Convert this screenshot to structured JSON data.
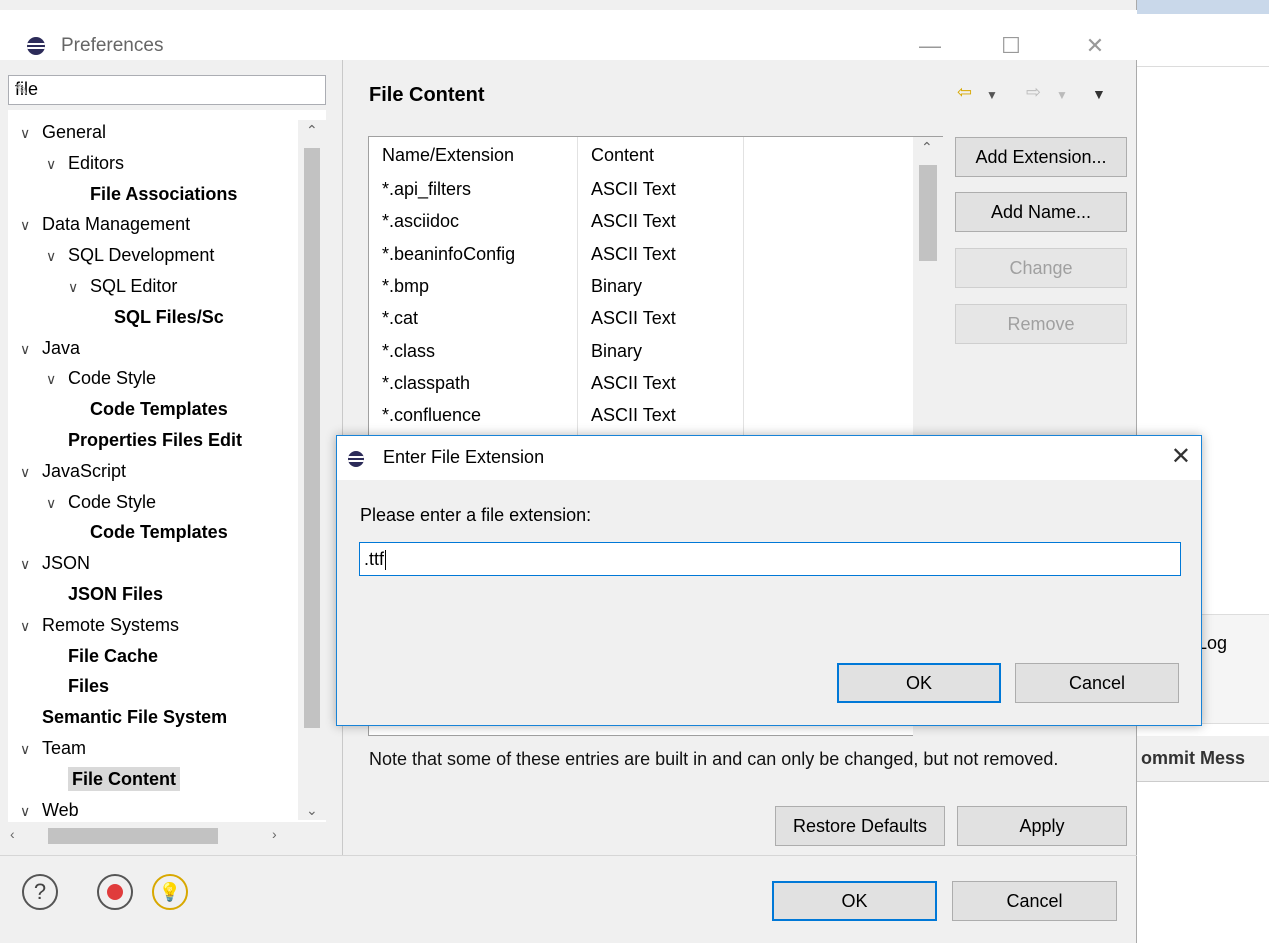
{
  "window": {
    "title": "Preferences",
    "minimize_glyph": "—",
    "maximize_glyph": "☐",
    "close_glyph": "✕"
  },
  "filter": {
    "value": "file",
    "clear_icon": "eraser-icon"
  },
  "tree": [
    {
      "label": "General",
      "level": 0,
      "expanded": true,
      "bold": false
    },
    {
      "label": "Editors",
      "level": 1,
      "expanded": true,
      "bold": false
    },
    {
      "label": "File Associations",
      "level": 2,
      "bold": true
    },
    {
      "label": "Data Management",
      "level": 0,
      "expanded": true,
      "bold": false
    },
    {
      "label": "SQL Development",
      "level": 1,
      "expanded": true,
      "bold": false
    },
    {
      "label": "SQL Editor",
      "level": 2,
      "expanded": true,
      "bold": false
    },
    {
      "label": "SQL Files/Sc",
      "level": 3,
      "bold": true
    },
    {
      "label": "Java",
      "level": 0,
      "expanded": true,
      "bold": false
    },
    {
      "label": "Code Style",
      "level": 1,
      "expanded": true,
      "bold": false
    },
    {
      "label": "Code Templates",
      "level": 2,
      "bold": true
    },
    {
      "label": "Properties Files Edit",
      "level": 1,
      "bold": true
    },
    {
      "label": "JavaScript",
      "level": 0,
      "expanded": true,
      "bold": false
    },
    {
      "label": "Code Style",
      "level": 1,
      "expanded": true,
      "bold": false
    },
    {
      "label": "Code Templates",
      "level": 2,
      "bold": true
    },
    {
      "label": "JSON",
      "level": 0,
      "expanded": true,
      "bold": false
    },
    {
      "label": "JSON Files",
      "level": 1,
      "bold": true
    },
    {
      "label": "Remote Systems",
      "level": 0,
      "expanded": true,
      "bold": false
    },
    {
      "label": "File Cache",
      "level": 1,
      "bold": true
    },
    {
      "label": "Files",
      "level": 1,
      "bold": true
    },
    {
      "label": "Semantic File System",
      "level": 0,
      "bold": true
    },
    {
      "label": "Team",
      "level": 0,
      "expanded": true,
      "bold": false
    },
    {
      "label": "File Content",
      "level": 1,
      "bold": true,
      "selected": true
    },
    {
      "label": "Web",
      "level": 0,
      "expanded": true,
      "bold": false
    }
  ],
  "page": {
    "title": "File Content",
    "back_icon": "back-arrow-icon",
    "forward_icon": "forward-arrow-icon",
    "menu_icon": "view-menu-icon"
  },
  "table": {
    "headers": [
      "Name/Extension",
      "Content"
    ],
    "rows": [
      [
        "*.api_filters",
        "ASCII Text"
      ],
      [
        "*.asciidoc",
        "ASCII Text"
      ],
      [
        "*.beaninfoConfig",
        "ASCII Text"
      ],
      [
        "*.bmp",
        "Binary"
      ],
      [
        "*.cat",
        "ASCII Text"
      ],
      [
        "*.class",
        "Binary"
      ],
      [
        "*.classpath",
        "ASCII Text"
      ],
      [
        "*.confluence",
        "ASCII Text"
      ]
    ]
  },
  "side_buttons": {
    "add_extension": "Add Extension...",
    "add_name": "Add Name...",
    "change": "Change",
    "remove": "Remove"
  },
  "note": "Note that some of these entries are built in and can only be changed, but not removed.",
  "restore_defaults": "Restore Defaults",
  "apply": "Apply",
  "footer": {
    "ok": "OK",
    "cancel": "Cancel"
  },
  "footer_icons": [
    "help-icon",
    "record-icon",
    "tip-bulb-icon"
  ],
  "dialog": {
    "title": "Enter File Extension",
    "prompt": "Please enter a file extension:",
    "input_value": ".ttf",
    "ok": "OK",
    "cancel": "Cancel",
    "close_glyph": "✕"
  },
  "background": {
    "error_log_tab": "r Log",
    "commit_label": "ommit Mess"
  }
}
